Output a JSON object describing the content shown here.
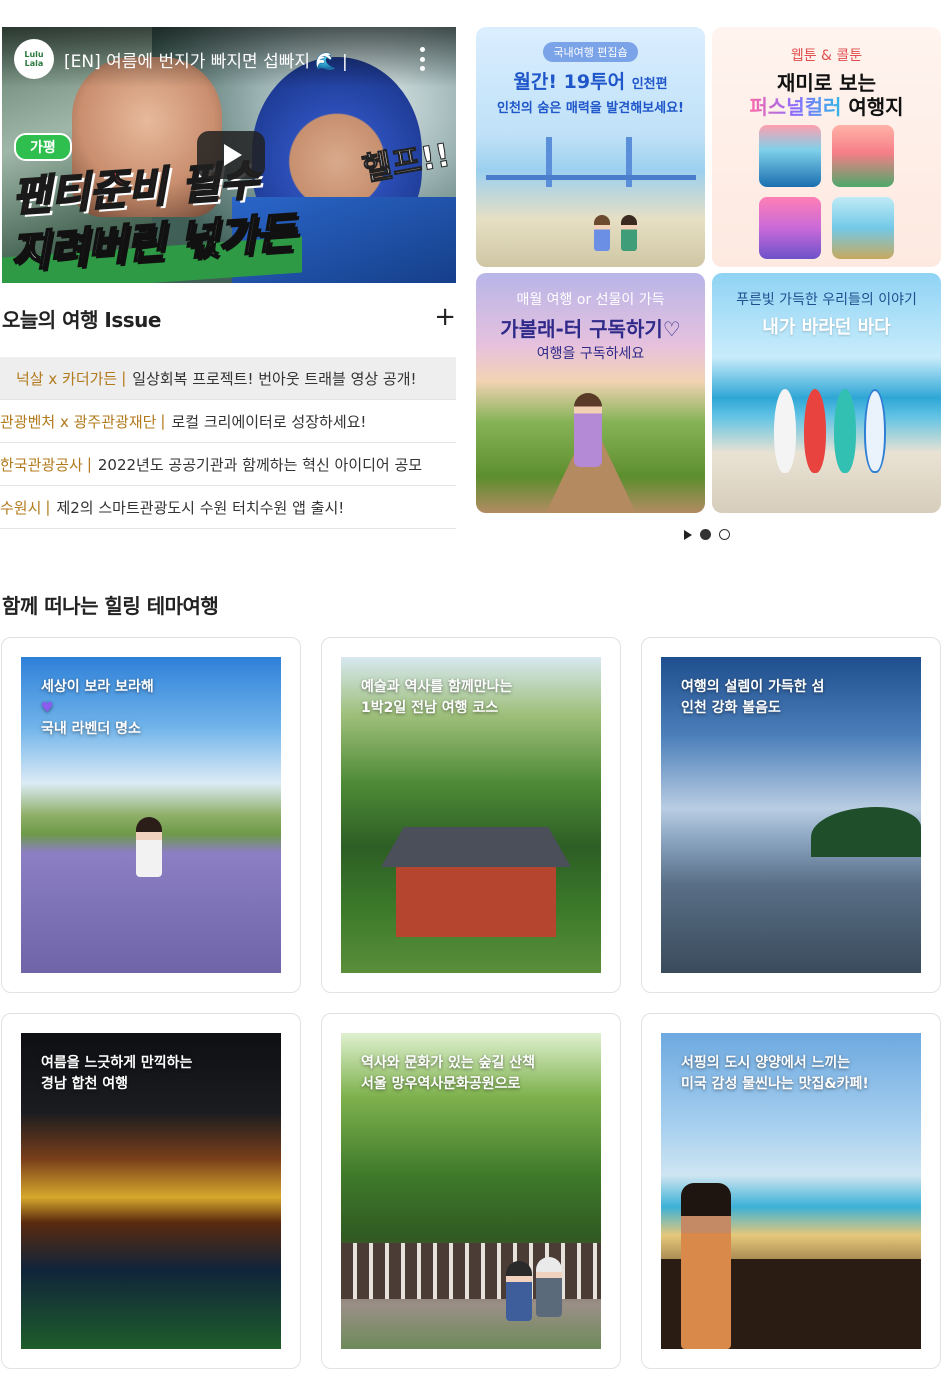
{
  "video": {
    "channel_logo_line1": "Lulu",
    "channel_logo_line2": "Lala",
    "title": "[EN] 여름에 번지가 빠지면 섭빠지 🌊 |",
    "tag": "가평",
    "caption_line1": "팬티준비 필수",
    "caption_line2": "지려버린 넋가든",
    "callout": "헬프!!"
  },
  "issue": {
    "title": "오늘의 여행 Issue",
    "more": "+",
    "items": [
      {
        "org": "넉살 x 카더가든",
        "text": "일상회복 프로젝트! 번아웃 트래블 영상 공개!"
      },
      {
        "org": "관광벤처 x 광주관광재단",
        "text": "로컬 크리에이터로 성장하세요!"
      },
      {
        "org": "한국관광공사",
        "text": "2022년도 공공기관과 함께하는 혁신 아이디어 공모"
      },
      {
        "org": "수원시",
        "text": "제2의 스마트관광도시 수원 터치수원 앱 출시!"
      }
    ]
  },
  "banners": {
    "b1": {
      "pill": "국내여행 편집숍",
      "title": "월간! 19투어",
      "title_small": "인천편",
      "sub": "인천의 숨은 매력을 발견해보세요!"
    },
    "b2": {
      "line1": "웹툰 & 콜툰",
      "line2": "재미로 보는",
      "line3_color": "퍼스널컬러",
      "line3_rest": " 여행지"
    },
    "b3": {
      "line1": "매월 여행 or 선물이 가득",
      "line2": "가볼래-터 구독하기♡",
      "line3": "여행을 구독하세요"
    },
    "b4": {
      "line1": "푸른빛 가득한 우리들의 이야기",
      "line2": "내가 바라던 바다"
    }
  },
  "theme": {
    "title": "함께 떠나는 힐링 테마여행",
    "cards": [
      {
        "line1": "세상이 보라 보라해",
        "heart": "💜",
        "line2": "국내 라벤더 명소"
      },
      {
        "line1": "예술과 역사를 함께만나는",
        "line2": "1박2일 전남 여행 코스"
      },
      {
        "line1": "여행의 설렘이 가득한 섬",
        "line2": "인천 강화 볼음도"
      },
      {
        "line1": "여름을 느긋하게 만끽하는",
        "line2": "경남 합천 여행"
      },
      {
        "line1": "역사와 문화가 있는 숲길 산책",
        "line2": "서울 망우역사문화공원으로"
      },
      {
        "line1": "서핑의 도시 양양에서 느끼는",
        "line2": "미국 감성 물씬나는 맛집&카페!"
      }
    ]
  },
  "pager": {
    "active": 1,
    "count": 2
  }
}
